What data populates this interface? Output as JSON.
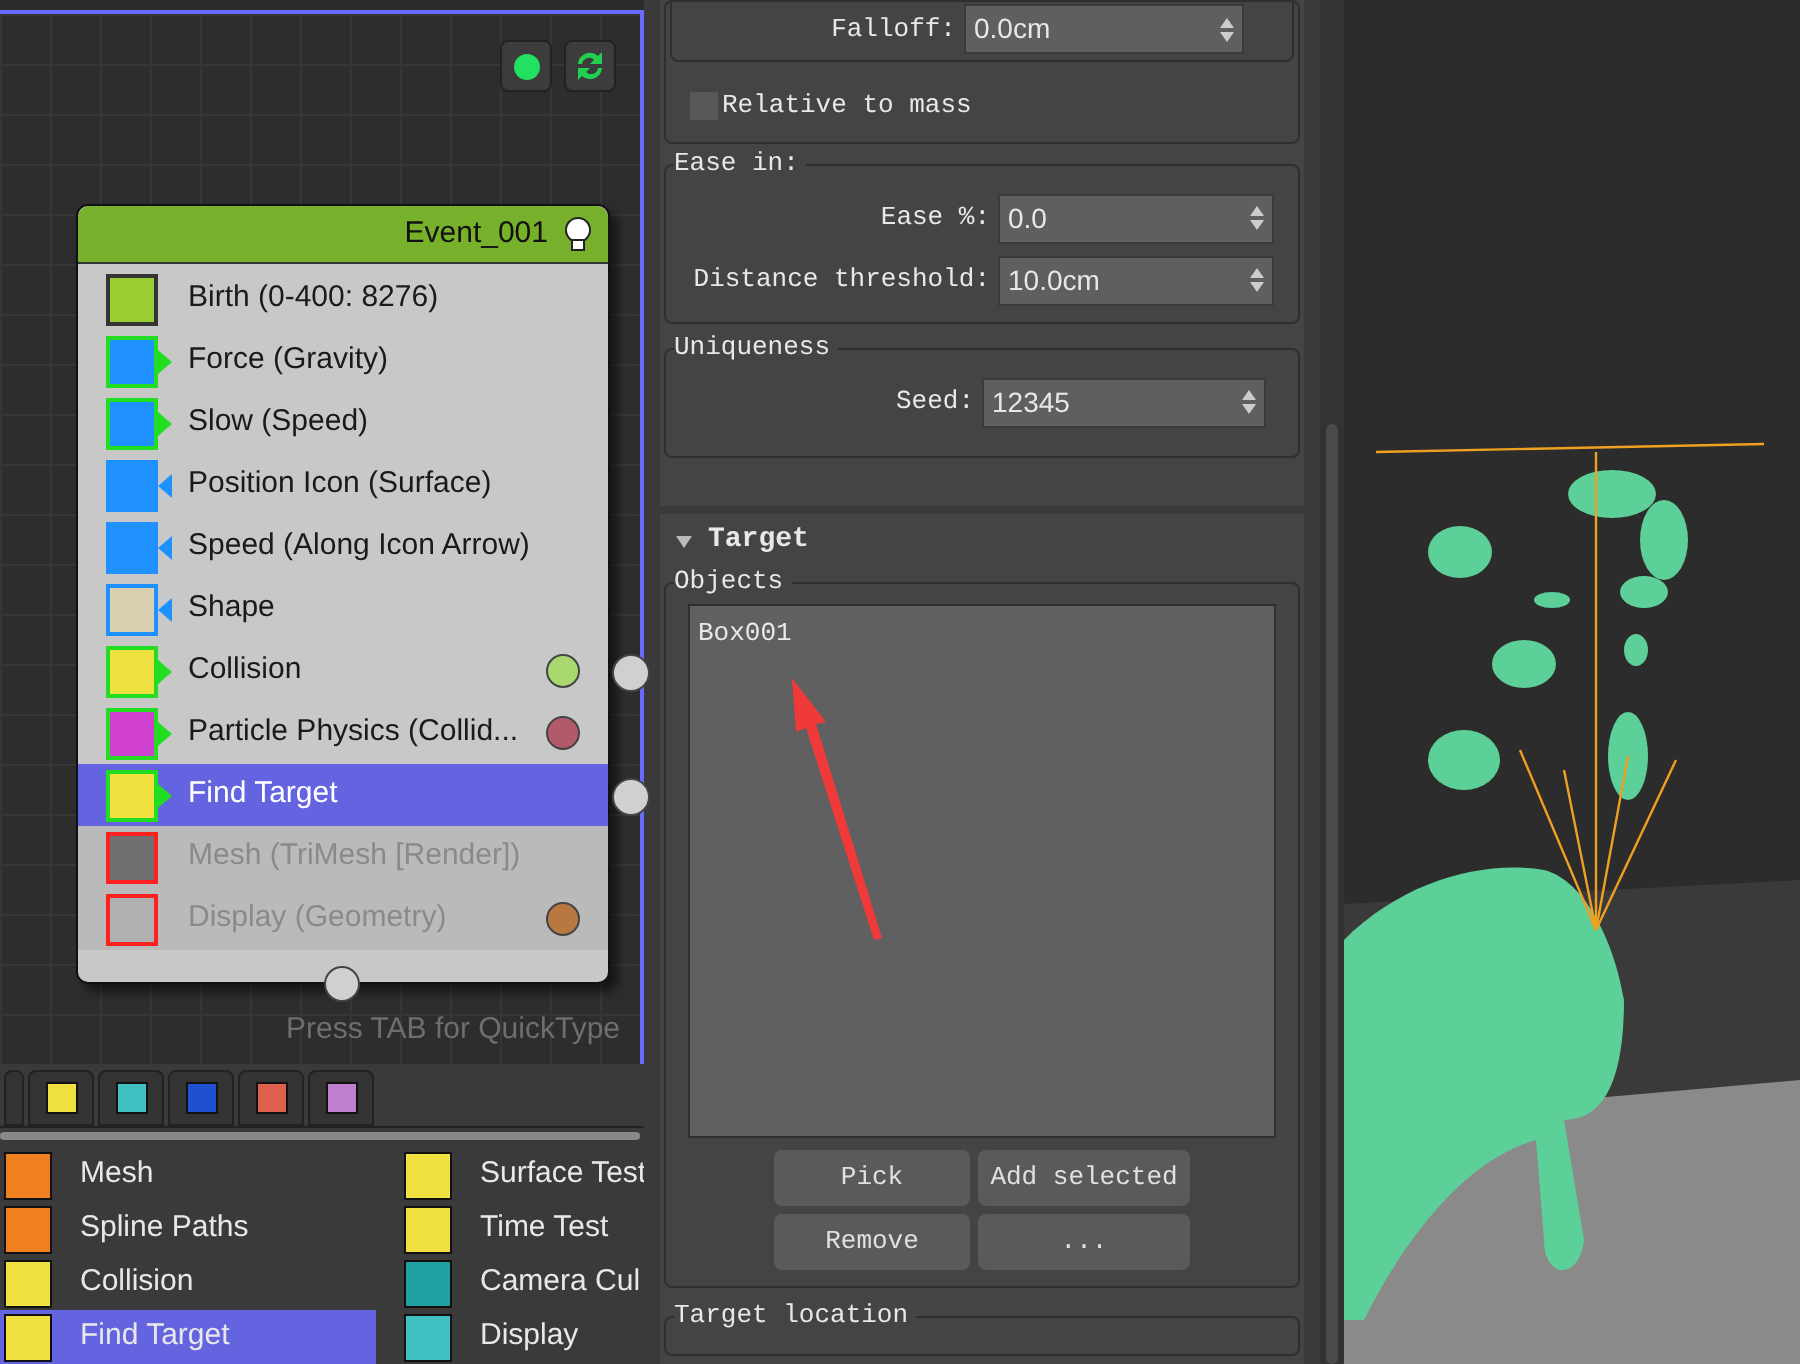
{
  "event": {
    "title": "Event_001",
    "operators": [
      {
        "name": "Birth (0-400: 8276)",
        "kind": "source",
        "selected": false,
        "disabled": false,
        "output": false
      },
      {
        "name": "Force (Gravity)",
        "kind": "test",
        "selected": false,
        "disabled": false,
        "output": false
      },
      {
        "name": "Slow (Speed)",
        "kind": "test",
        "selected": false,
        "disabled": false,
        "output": false
      },
      {
        "name": "Position Icon (Surface)",
        "kind": "operator",
        "selected": false,
        "disabled": false,
        "output": false
      },
      {
        "name": "Speed (Along Icon Arrow)",
        "kind": "operator",
        "selected": false,
        "disabled": false,
        "output": false
      },
      {
        "name": "Shape",
        "kind": "operator",
        "selected": false,
        "disabled": false,
        "output": false
      },
      {
        "name": "Collision",
        "kind": "test",
        "selected": false,
        "disabled": false,
        "output": true,
        "color": "#a8d86e"
      },
      {
        "name": "Particle Physics (Collid...",
        "kind": "test",
        "selected": false,
        "disabled": false,
        "output": false,
        "color": "#b35a6a"
      },
      {
        "name": "Find Target",
        "kind": "test",
        "selected": true,
        "disabled": false,
        "output": true
      },
      {
        "name": "Mesh (TriMesh [Render])",
        "kind": "source",
        "selected": false,
        "disabled": true,
        "output": false
      },
      {
        "name": "Display (Geometry)",
        "kind": "source",
        "selected": false,
        "disabled": true,
        "output": false,
        "color": "#b87840"
      }
    ]
  },
  "hint": "Press TAB for QuickType",
  "depot": {
    "items": [
      {
        "name": "Mesh",
        "selected": false
      },
      {
        "name": "Spline Paths",
        "selected": false
      },
      {
        "name": "Collision",
        "selected": false
      },
      {
        "name": "Find Target",
        "selected": true
      },
      {
        "name": "Surface Test",
        "selected": false
      },
      {
        "name": "Time Test",
        "selected": false
      },
      {
        "name": "Camera Cul",
        "selected": false
      },
      {
        "name": "Display",
        "selected": false
      }
    ]
  },
  "panel": {
    "falloff": {
      "label": "Falloff:",
      "value": "0.0cm"
    },
    "relative_to_mass": {
      "label": "Relative to mass",
      "checked": false
    },
    "ease_in": {
      "title": "Ease in:",
      "fields": [
        {
          "label": "Ease %:",
          "value": "0.0"
        },
        {
          "label": "Distance threshold:",
          "value": "10.0cm"
        }
      ]
    },
    "uniqueness": {
      "title": "Uniqueness",
      "seed": {
        "label": "Seed:",
        "value": "12345"
      }
    },
    "target": {
      "title": "Target",
      "expanded": true,
      "objects_title": "Objects",
      "objects": [
        "Box001"
      ],
      "buttons": [
        "Pick",
        "Add selected",
        "Remove",
        "..."
      ]
    },
    "target_location": {
      "title": "Target location"
    }
  }
}
